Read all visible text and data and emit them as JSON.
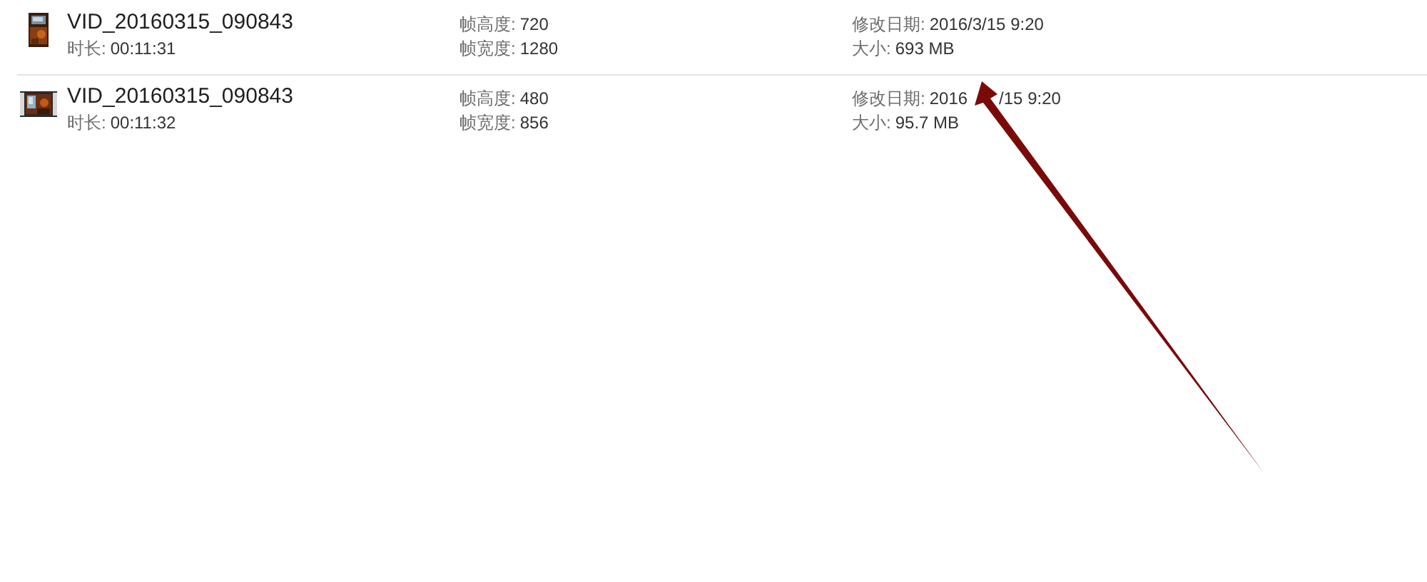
{
  "files": [
    {
      "name": "VID_20160315_090843",
      "kind": "portrait",
      "duration": {
        "label": "时长:",
        "value": "00:11:31"
      },
      "column_2": [
        {
          "label": "帧高度:",
          "value": "720"
        },
        {
          "label": "帧宽度:",
          "value": "1280"
        }
      ],
      "column_3": [
        {
          "label": "修改日期:",
          "value": "2016/3/15 9:20"
        },
        {
          "label": "大小:",
          "value": "693 MB"
        }
      ]
    },
    {
      "name": "VID_20160315_090843",
      "kind": "landscape",
      "duration": {
        "label": "时长:",
        "value": "00:11:32"
      },
      "column_2": [
        {
          "label": "帧高度:",
          "value": "480"
        },
        {
          "label": "帧宽度:",
          "value": "856"
        }
      ],
      "column_3": [
        {
          "label": "修改日期:",
          "value_parts": [
            "2016",
            "/15 9:20"
          ]
        },
        {
          "label": "大小:",
          "value": "95.7 MB"
        }
      ]
    }
  ]
}
